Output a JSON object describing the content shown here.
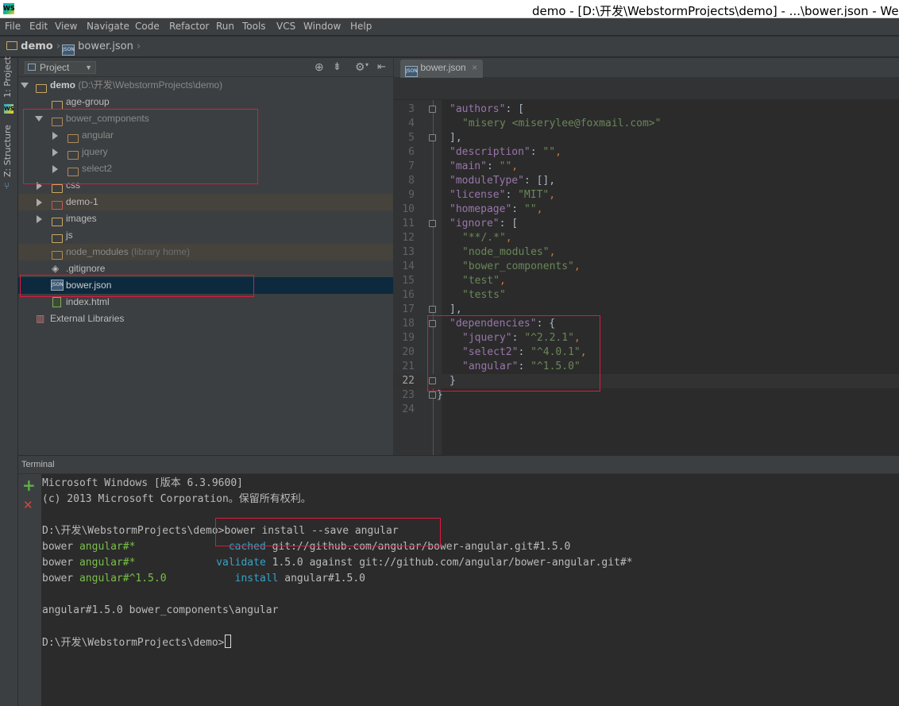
{
  "window": {
    "title": "demo - [D:\\开发\\WebstormProjects\\demo] - ...\\bower.json - We"
  },
  "menu": [
    "File",
    "Edit",
    "View",
    "Navigate",
    "Code",
    "Refactor",
    "Run",
    "Tools",
    "VCS",
    "Window",
    "Help"
  ],
  "breadcrumb": [
    "demo",
    "bower.json"
  ],
  "side_tabs": {
    "project": "1: Project",
    "structure": "Z: Structure"
  },
  "project_panel": {
    "view_label": "Project",
    "tree": [
      {
        "label": "demo",
        "suffix": "(D:\\开发\\WebstormProjects\\demo)",
        "type": "folder",
        "expanded": true
      },
      {
        "label": "age-group",
        "type": "folder"
      },
      {
        "label": "bower_components",
        "type": "folder",
        "expanded": true
      },
      {
        "label": "angular",
        "type": "folder",
        "collapsed": true
      },
      {
        "label": "jquery",
        "type": "folder",
        "collapsed": true
      },
      {
        "label": "select2",
        "type": "folder",
        "collapsed": true
      },
      {
        "label": "css",
        "type": "folder",
        "collapsed": true
      },
      {
        "label": "demo-1",
        "type": "folder",
        "collapsed": true
      },
      {
        "label": "images",
        "type": "folder",
        "collapsed": true
      },
      {
        "label": "js",
        "type": "folder"
      },
      {
        "label": "node_modules",
        "suffix": "(library home)",
        "type": "folder"
      },
      {
        "label": ".gitignore",
        "type": "file"
      },
      {
        "label": "bower.json",
        "type": "file",
        "selected": true
      },
      {
        "label": "index.html",
        "type": "file"
      },
      {
        "label": "External Libraries",
        "type": "library"
      }
    ]
  },
  "editor": {
    "tab_label": "bower.json",
    "tab_close": "×",
    "lines": [
      {
        "n": "3",
        "key": "\"authors\"",
        "rest": ": ["
      },
      {
        "n": "4",
        "indent": 1,
        "str": "\"misery <miserylee@foxmail.com>\""
      },
      {
        "n": "5",
        "raw": "],"
      },
      {
        "n": "6",
        "key": "\"description\"",
        "rest": ": ",
        "val": "\"\"",
        "tail": ","
      },
      {
        "n": "7",
        "key": "\"main\"",
        "rest": ": ",
        "val": "\"\"",
        "tail": ","
      },
      {
        "n": "8",
        "key": "\"moduleType\"",
        "rest": ": [],"
      },
      {
        "n": "9",
        "key": "\"license\"",
        "rest": ": ",
        "val": "\"MIT\"",
        "tail": ","
      },
      {
        "n": "10",
        "key": "\"homepage\"",
        "rest": ": ",
        "val": "\"\"",
        "tail": ","
      },
      {
        "n": "11",
        "key": "\"ignore\"",
        "rest": ": ["
      },
      {
        "n": "12",
        "indent": 1,
        "str": "\"**/.*\"",
        "tail": ","
      },
      {
        "n": "13",
        "indent": 1,
        "str": "\"node_modules\"",
        "tail": ","
      },
      {
        "n": "14",
        "indent": 1,
        "str": "\"bower_components\"",
        "tail": ","
      },
      {
        "n": "15",
        "indent": 1,
        "str": "\"test\"",
        "tail": ","
      },
      {
        "n": "16",
        "indent": 1,
        "str": "\"tests\""
      },
      {
        "n": "17",
        "raw": "],"
      },
      {
        "n": "18",
        "key": "\"dependencies\"",
        "rest": ": {"
      },
      {
        "n": "19",
        "indent": 1,
        "key": "\"jquery\"",
        "rest": ": ",
        "val": "\"^2.2.1\"",
        "tail": ","
      },
      {
        "n": "20",
        "indent": 1,
        "key": "\"select2\"",
        "rest": ": ",
        "val": "\"^4.0.1\"",
        "tail": ","
      },
      {
        "n": "21",
        "indent": 1,
        "key": "\"angular\"",
        "rest": ": ",
        "val": "\"^1.5.0\""
      },
      {
        "n": "22",
        "raw": "}"
      },
      {
        "n": "23",
        "raw": "}",
        "outdent": true
      },
      {
        "n": "24",
        "raw": ""
      }
    ]
  },
  "terminal": {
    "title": "Terminal",
    "add_label": "+",
    "close_label": "✕",
    "lines": [
      {
        "text": "Microsoft Windows [版本 6.3.9600]"
      },
      {
        "text": "(c) 2013 Microsoft Corporation。保留所有权利。"
      },
      {
        "text": ""
      },
      {
        "text": "D:\\开发\\WebstormProjects\\demo>bower install --save angular"
      },
      {
        "a": "bower ",
        "b": "angular#*",
        "c": "               cached",
        "d": " git://github.com/angular/bower-angular.git#1.5.0"
      },
      {
        "a": "bower ",
        "b": "angular#*",
        "c": "             validate",
        "d": " 1.5.0 against git://github.com/angular/bower-angular.git#*"
      },
      {
        "a": "bower ",
        "b": "angular#^1.5.0",
        "c": "           install",
        "d": " angular#1.5.0"
      },
      {
        "text": ""
      },
      {
        "text": "angular#1.5.0 bower_components\\angular"
      },
      {
        "text": ""
      },
      {
        "text": "D:\\开发\\WebstormProjects\\demo>",
        "cursor": true
      }
    ]
  }
}
